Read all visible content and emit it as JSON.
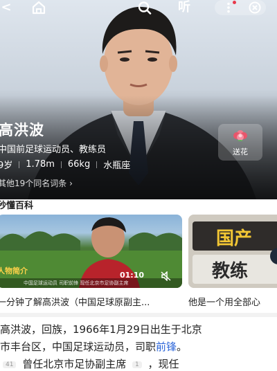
{
  "topbar": {
    "back_glyph": "<",
    "home_icon": "home-icon",
    "search_icon": "search-icon",
    "listen_label": "听",
    "more_icon": "more-vertical-icon",
    "close_icon": "close-circle-icon"
  },
  "person": {
    "name": "高洪波",
    "description": "中国前足球运动员、教练员",
    "age": "9岁",
    "height": "1.78m",
    "weight": "66kg",
    "zodiac": "水瓶座",
    "more_link": "其他19个同名词条 ›"
  },
  "flower": {
    "label": "送花",
    "icon": "flower-icon"
  },
  "section": {
    "title": "秒懂百科"
  },
  "videos": [
    {
      "tag": "人物简介",
      "subtitle": "中国足球运动员 司职前锋 现任北京市足协副主席",
      "time": "01:10",
      "title": "一分钟了解高洪波（中国足球原副主..."
    },
    {
      "title": "他是一个用全部心"
    }
  ],
  "body": {
    "line1": "高洪波，回族，1966年1月29日出生于北京",
    "line2_prefix": "市丰台区，中国足球运动员，司职",
    "line2_link": "前锋",
    "line2_suffix": "。",
    "line3_ref1": "41",
    "line3_text": "曾任北京市足协副主席",
    "line3_ref2": "1",
    "line3_suffix": "，现任"
  },
  "colors": {
    "link": "#2a64d8",
    "flower_accent": "#e8556b"
  }
}
